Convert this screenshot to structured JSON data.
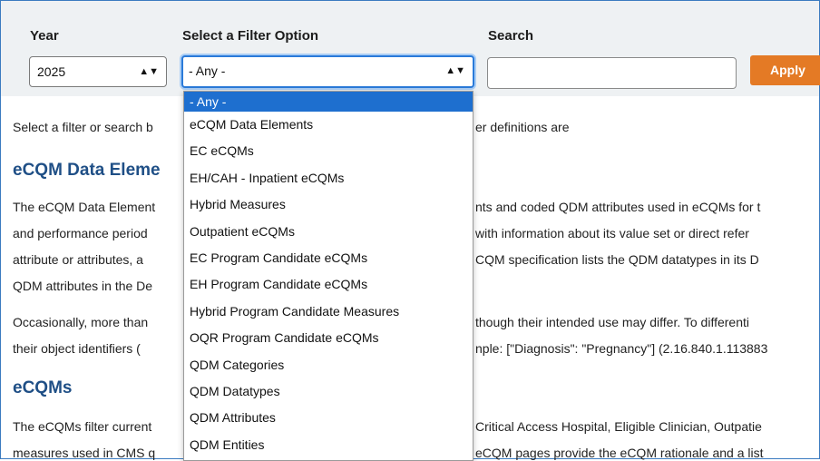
{
  "filters": {
    "year_label": "Year",
    "year_value": "2025",
    "filter_label": "Select a Filter Option",
    "filter_value": "- Any -",
    "search_label": "Search",
    "search_value": "",
    "apply_label": "Apply"
  },
  "dropdown": {
    "options": [
      "- Any -",
      "eCQM Data Elements",
      "EC eCQMs",
      "EH/CAH - Inpatient eCQMs",
      "Hybrid Measures",
      "Outpatient eCQMs",
      "EC Program Candidate eCQMs",
      "EH Program Candidate eCQMs",
      "Hybrid Program Candidate Measures",
      "OQR Program Candidate eCQMs",
      "QDM Categories",
      "QDM Datatypes",
      "QDM Attributes",
      "QDM Entities"
    ]
  },
  "content": {
    "intro_left": "Select a filter or search b",
    "intro_right": "er definitions are",
    "h1_left": "eCQM Data Eleme",
    "p1_l1_left": "The eCQM Data Element",
    "p1_l1_right": "nts and coded QDM attributes used in eCQMs for t",
    "p1_l2_left": "and performance period",
    "p1_l2_right": "with information about its value set or direct refer",
    "p1_l3_left": "attribute or attributes, a",
    "p1_l3_right": "CQM specification lists the QDM datatypes in its D",
    "p1_l4_left": "QDM attributes in the De",
    "p2_l1_left": "Occasionally, more than",
    "p2_l1_right": "though their intended use may differ. To differenti",
    "p2_l2_left": "their object identifiers (",
    "p2_l2_right": "nple: [\"Diagnosis\": \"Pregnancy\"] (2.16.840.1.113883",
    "h2": "eCQMs",
    "p3_l1_left": "The eCQMs filter current",
    "p3_l1_right": "Critical Access Hospital, Eligible Clinician, Outpatie",
    "p3_l2_left": "measures used in CMS q",
    "p3_l2_right": "eCQM pages provide the eCQM rationale and a list"
  }
}
